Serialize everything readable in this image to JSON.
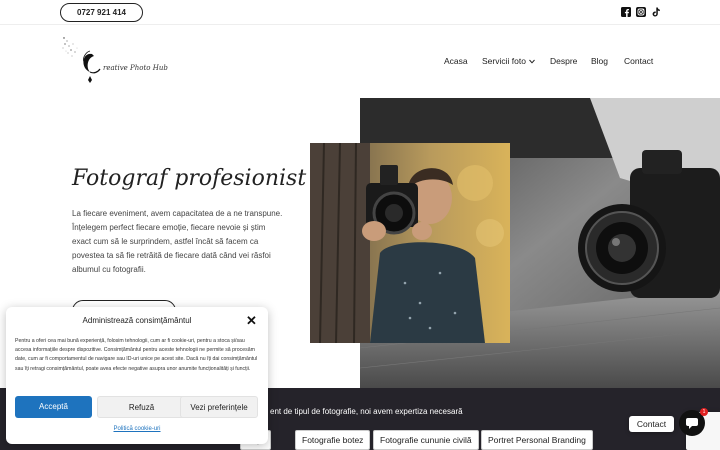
{
  "topbar": {
    "phone": "0727 921 414",
    "social_icons": [
      "facebook-icon",
      "instagram-icon",
      "tiktok-icon"
    ]
  },
  "logo": {
    "text": "reative Photo Hub"
  },
  "menu": {
    "items": [
      "Acasa",
      "Servicii foto",
      "Despre",
      "Blog",
      "Contact"
    ]
  },
  "hero": {
    "title": "Fotograf profesionist",
    "text": "La fiecare eveniment, avem capacitatea de a ne transpune. Înțelegem perfect fiecare emoție, fiecare nevoie și știm exact cum să le surprindem, astfel încât să facem ca povestea ta să fie retrăită de fiecare dată când vei răsfoi albumul cu fotografii."
  },
  "band": {
    "text": "ent de tipul de fotografie, noi avem expertiza necesară",
    "chips": [
      "unță",
      "Fotografie botez",
      "Fotografie cununie civilă",
      "Portret Personal Branding"
    ]
  },
  "cookie": {
    "title": "Administrează consimțământul",
    "body": "Pentru a oferi cea mai bună experiență, folosim tehnologii, cum ar fi cookie-uri, pentru a stoca și/sau accesa informațiile despre dispozitive. Consimțământul pentru aceste tehnologii ne permite să procesăm date, cum ar fi comportamentul de navigare sau ID-uri unice pe acest site. Dacă nu îți dai consimțământul sau îți retragi consimțământul, poate avea efecte negative asupra unor anumite funcționalități și funcții.",
    "accept": "Acceptă",
    "refuse": "Refuză",
    "preferences": "Vezi preferințele",
    "policy": "Politică cookie-uri"
  },
  "chat": {
    "contact_label": "Contact",
    "badge": "1"
  },
  "colors": {
    "accent": "#1e73be",
    "dark_band": "#25232a"
  }
}
